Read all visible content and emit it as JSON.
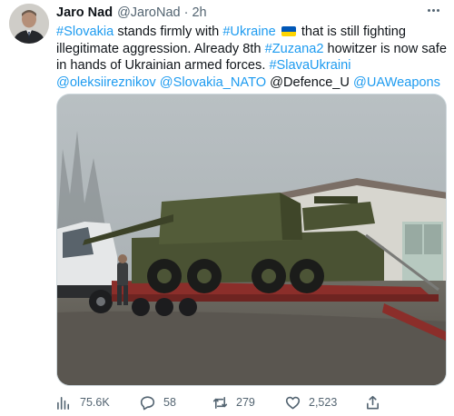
{
  "tweet": {
    "author_name": "Jaro Nad",
    "author_handle": "@JaroNad",
    "separator": "·",
    "time": "2h",
    "text": {
      "hashtag_slovakia": "#Slovakia",
      "t1": " stands firmly with ",
      "hashtag_ukraine": "#Ukraine",
      "t2": " that is still fighting illegitimate aggression. Already 8th ",
      "hashtag_zuzana": "#Zuzana2",
      "t3": " howitzer is now safe in hands of Ukrainian armed forces. ",
      "hashtag_slava": "#SlavaUkraini",
      "mention_1": "@oleksiireznikov",
      "mention_2": "@Slovakia_NATO",
      "t4": "@Defence_U",
      "mention_3": "@UAWeapons"
    },
    "flag_colors": {
      "top": "#0057b7",
      "bottom": "#ffd500"
    }
  },
  "actions": {
    "views": "75.6K",
    "replies": "58",
    "retweets": "279",
    "likes": "2,523"
  },
  "icons": {
    "more": "more-horizontal-icon",
    "views": "views-icon",
    "reply": "reply-icon",
    "retweet": "retweet-icon",
    "like": "heart-icon",
    "share": "share-icon"
  },
  "colors": {
    "link": "#1d9bf0",
    "text": "#0f1419",
    "secondary": "#536471"
  }
}
